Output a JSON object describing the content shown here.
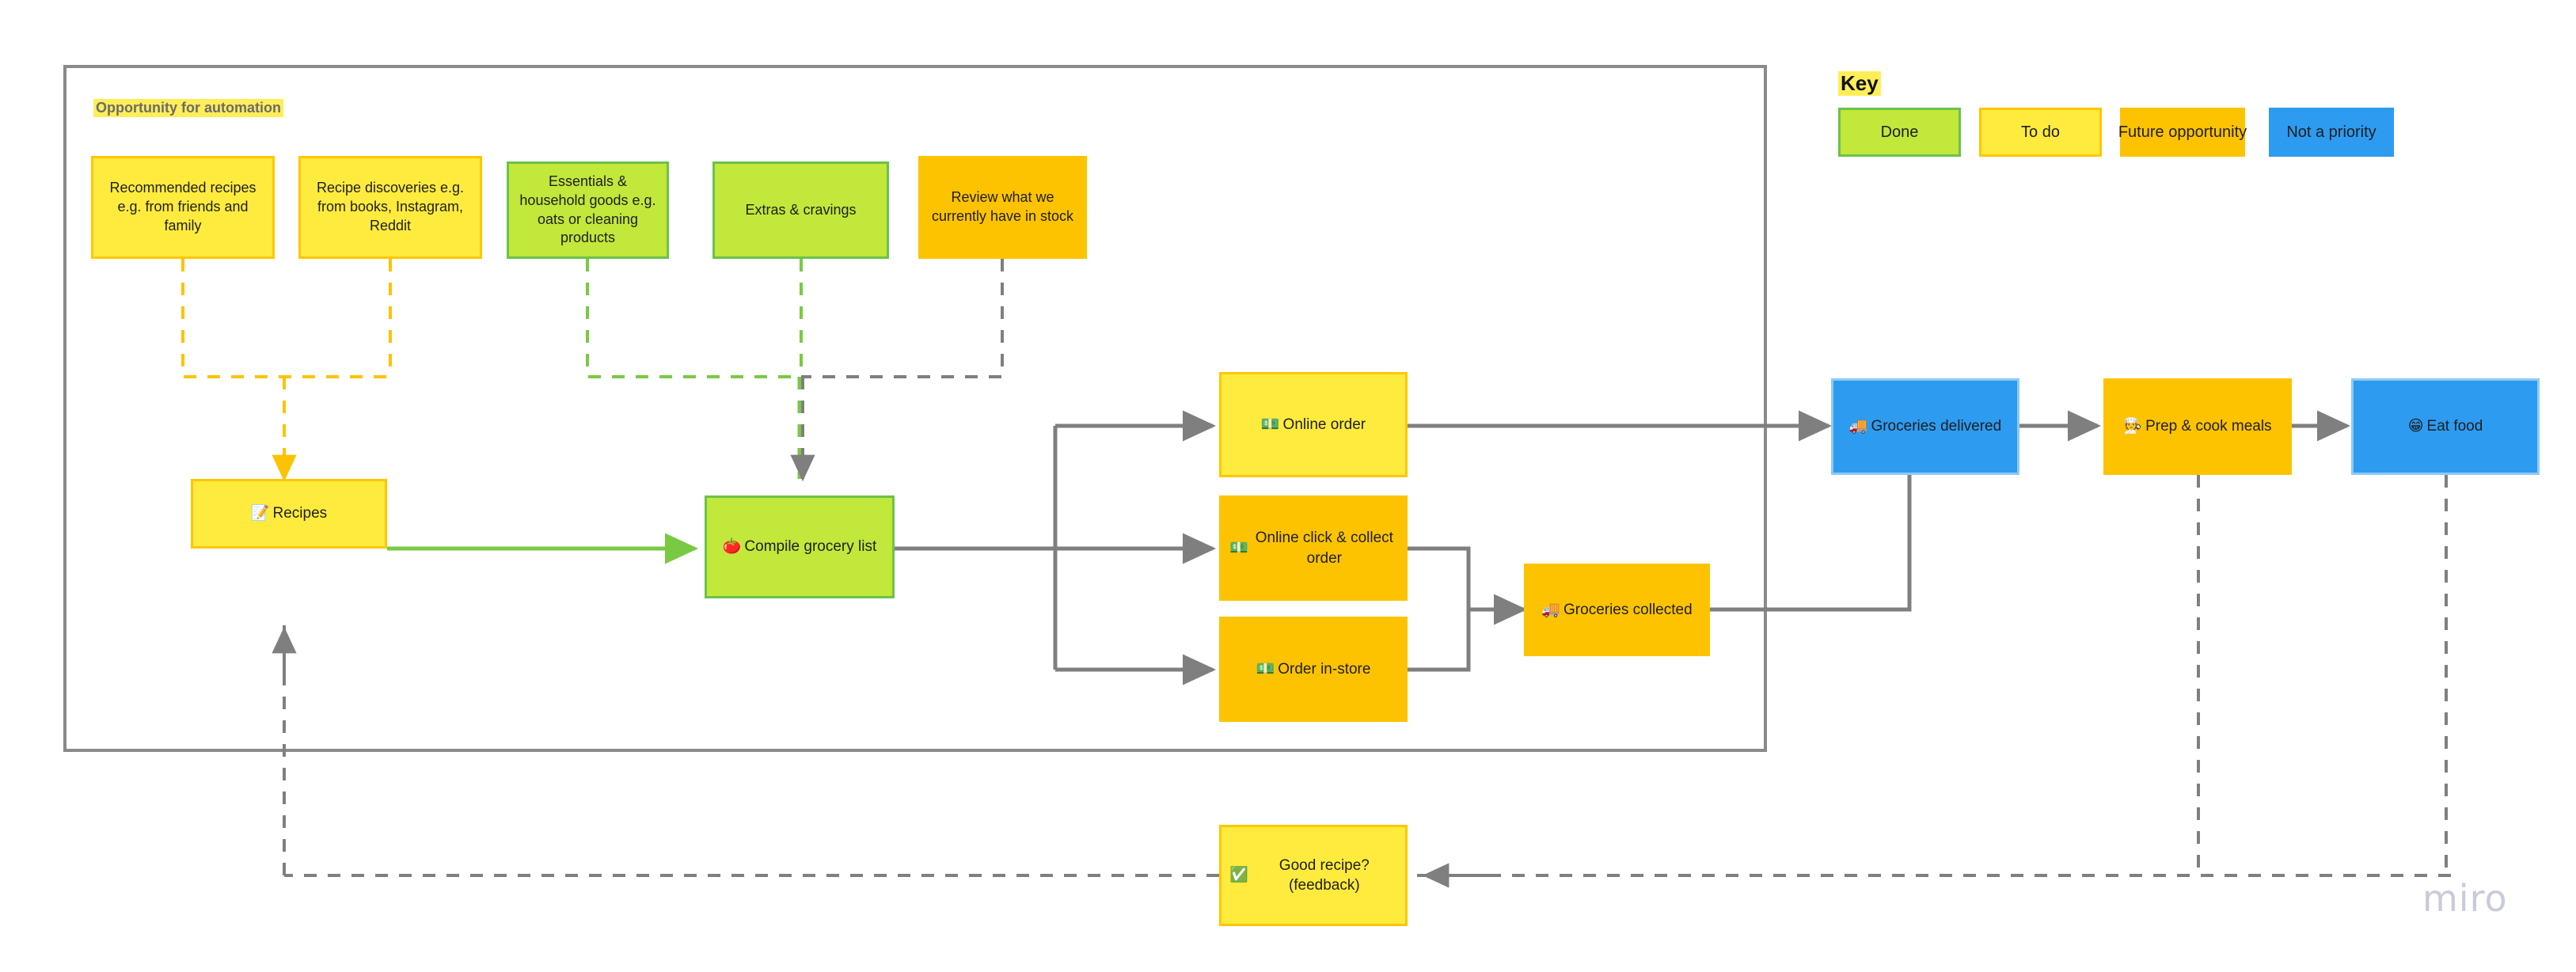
{
  "board": {
    "watermark": "miro",
    "group_label": "Opportunity for automation"
  },
  "key": {
    "title": "Key",
    "items": [
      {
        "label": "Done",
        "color": "#c2e83b",
        "swatch": "green"
      },
      {
        "label": "To do",
        "color": "#ffeb3d",
        "swatch": "yellow"
      },
      {
        "label": "Future opportunity",
        "color": "#fdc300",
        "swatch": "orange"
      },
      {
        "label": "Not a priority",
        "color": "#2d9bf0",
        "swatch": "blue"
      }
    ]
  },
  "nodes": {
    "recommended_recipes": {
      "text": "Recommended recipes e.g. from friends and family",
      "status": "To do"
    },
    "recipe_discoveries": {
      "text": "Recipe discoveries e.g. from books, Instagram, Reddit",
      "status": "To do"
    },
    "essentials": {
      "text": "Essentials & household goods e.g. oats or cleaning products",
      "status": "Done"
    },
    "extras": {
      "text": "Extras & cravings",
      "status": "Done"
    },
    "review_stock": {
      "text": "Review what we currently have in stock",
      "status": "Future opportunity"
    },
    "recipes": {
      "emoji": "📝",
      "text": "Recipes",
      "status": "To do"
    },
    "compile_list": {
      "emoji": "🍅",
      "text": "Compile grocery list",
      "status": "Done"
    },
    "online_order": {
      "emoji": "💵",
      "text": "Online order",
      "status": "To do"
    },
    "click_collect": {
      "emoji": "💵",
      "text": "Online click & collect order",
      "status": "Future opportunity"
    },
    "order_instore": {
      "emoji": "💵",
      "text": "Order in-store",
      "status": "Future opportunity"
    },
    "groceries_collected": {
      "emoji": "🚚",
      "text": "Groceries collected",
      "status": "Future opportunity"
    },
    "groceries_delivered": {
      "emoji": "🚚",
      "text": "Groceries delivered",
      "status": "Not a priority"
    },
    "prep_cook": {
      "emoji": "🧑‍🍳",
      "text": "Prep & cook meals",
      "status": "Future opportunity"
    },
    "eat_food": {
      "emoji": "😁",
      "text": "Eat food",
      "status": "Not a priority"
    },
    "good_recipe": {
      "emoji": "✅",
      "text": "Good recipe? (feedback)",
      "status": "To do"
    }
  },
  "colors": {
    "yellow": "#ffeb3d",
    "yellow_border": "#ffc700",
    "green": "#c2e83b",
    "green_border": "#6cc24a",
    "orange": "#fdc300",
    "blue": "#2d9bf0",
    "grey_line": "#7f7f7f",
    "frame_border": "#8a8a8a",
    "highlight": "#ffee58"
  }
}
